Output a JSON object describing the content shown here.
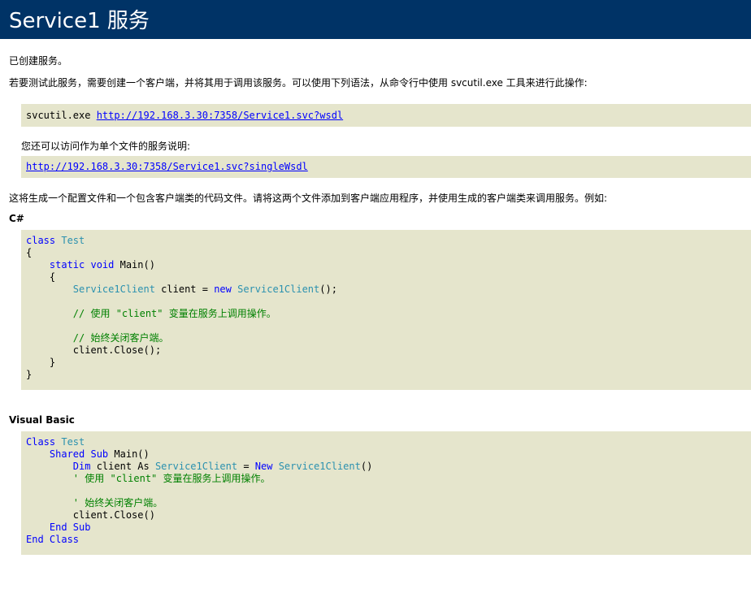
{
  "header": {
    "title": "Service1 服务"
  },
  "paragraphs": {
    "created": "已创建服务。",
    "test_instructions": "若要测试此服务，需要创建一个客户端，并将其用于调用该服务。可以使用下列语法，从命令行中使用 svcutil.exe 工具来进行此操作:",
    "single_file": "您还可以访问作为单个文件的服务说明:",
    "generate": "这将生成一个配置文件和一个包含客户端类的代码文件。请将这两个文件添加到客户端应用程序，并使用生成的客户端类来调用服务。例如:"
  },
  "svcutil": {
    "command": "svcutil.exe ",
    "wsdl_url": "http://192.168.3.30:7358/Service1.svc?wsdl",
    "single_wsdl_url": "http://192.168.3.30:7358/Service1.svc?singleWsdl"
  },
  "csharp": {
    "title": "C#",
    "lines": [
      [
        {
          "c": "kw",
          "t": "class "
        },
        {
          "c": "ty",
          "t": "Test"
        }
      ],
      [
        {
          "c": "pl",
          "t": "{"
        }
      ],
      [
        {
          "c": "pl",
          "t": "    "
        },
        {
          "c": "kw",
          "t": "static void "
        },
        {
          "c": "pl",
          "t": "Main()"
        }
      ],
      [
        {
          "c": "pl",
          "t": "    {"
        }
      ],
      [
        {
          "c": "pl",
          "t": "        "
        },
        {
          "c": "ty",
          "t": "Service1Client"
        },
        {
          "c": "pl",
          "t": " client = "
        },
        {
          "c": "kw",
          "t": "new "
        },
        {
          "c": "ty",
          "t": "Service1Client"
        },
        {
          "c": "pl",
          "t": "();"
        }
      ],
      [
        {
          "c": "pl",
          "t": ""
        }
      ],
      [
        {
          "c": "pl",
          "t": "        "
        },
        {
          "c": "cm",
          "t": "// 使用 \"client\" 变量在服务上调用操作。"
        }
      ],
      [
        {
          "c": "pl",
          "t": ""
        }
      ],
      [
        {
          "c": "pl",
          "t": "        "
        },
        {
          "c": "cm",
          "t": "// 始终关闭客户端。"
        }
      ],
      [
        {
          "c": "pl",
          "t": "        client.Close();"
        }
      ],
      [
        {
          "c": "pl",
          "t": "    }"
        }
      ],
      [
        {
          "c": "pl",
          "t": "}"
        }
      ]
    ]
  },
  "vb": {
    "title": "Visual Basic",
    "lines": [
      [
        {
          "c": "kw",
          "t": "Class "
        },
        {
          "c": "ty",
          "t": "Test"
        }
      ],
      [
        {
          "c": "pl",
          "t": "    "
        },
        {
          "c": "kw",
          "t": "Shared Sub "
        },
        {
          "c": "pl",
          "t": "Main()"
        }
      ],
      [
        {
          "c": "pl",
          "t": "        "
        },
        {
          "c": "kw",
          "t": "Dim "
        },
        {
          "c": "pl",
          "t": "client As "
        },
        {
          "c": "ty",
          "t": "Service1Client"
        },
        {
          "c": "pl",
          "t": " = "
        },
        {
          "c": "kw",
          "t": "New "
        },
        {
          "c": "ty",
          "t": "Service1Client"
        },
        {
          "c": "pl",
          "t": "()"
        }
      ],
      [
        {
          "c": "pl",
          "t": "        "
        },
        {
          "c": "cm",
          "t": "' 使用 \"client\" 变量在服务上调用操作。"
        }
      ],
      [
        {
          "c": "pl",
          "t": ""
        }
      ],
      [
        {
          "c": "pl",
          "t": "        "
        },
        {
          "c": "cm",
          "t": "' 始终关闭客户端。"
        }
      ],
      [
        {
          "c": "pl",
          "t": "        client.Close()"
        }
      ],
      [
        {
          "c": "pl",
          "t": "    "
        },
        {
          "c": "kw",
          "t": "End Sub"
        }
      ],
      [
        {
          "c": "kw",
          "t": "End Class"
        }
      ]
    ]
  },
  "colors": {
    "header_bg": "#003366",
    "code_bg": "#e5e5cc",
    "keyword": "#0000ff",
    "type": "#2b91af",
    "comment": "#008000",
    "link": "#0000ff"
  }
}
